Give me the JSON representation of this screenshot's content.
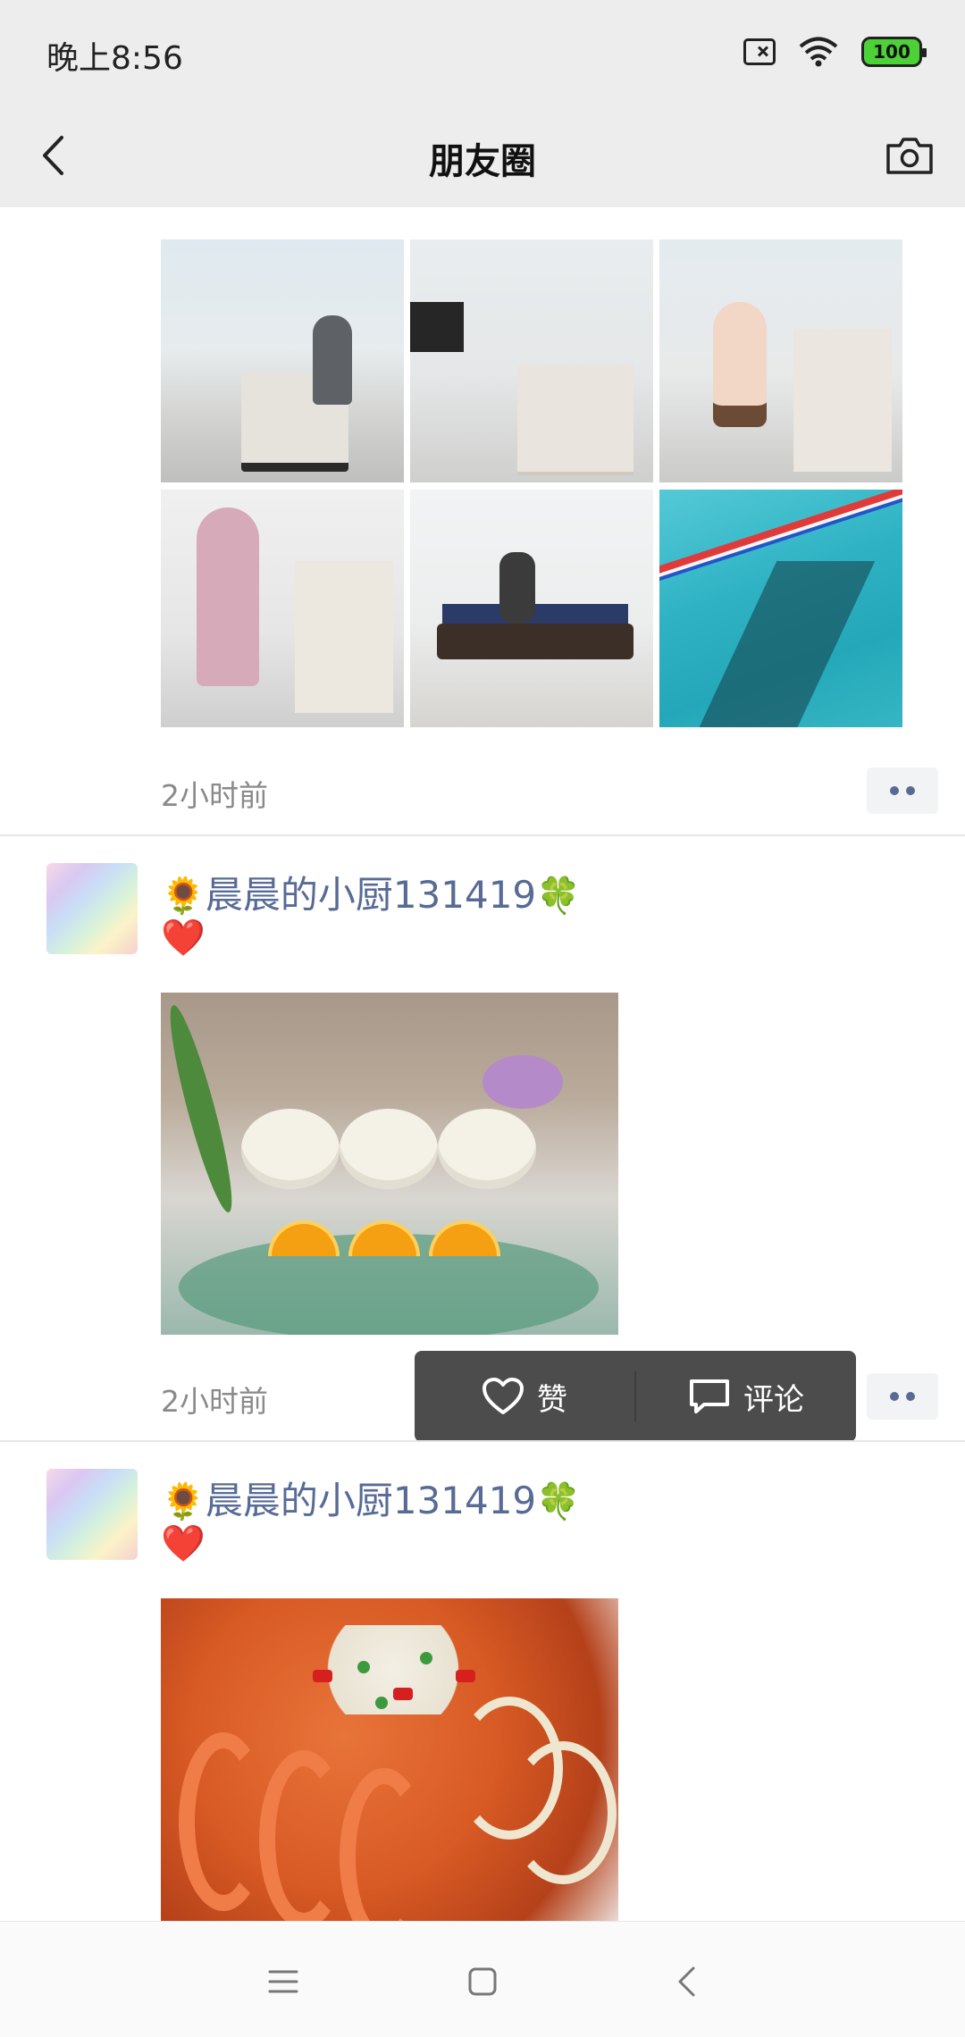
{
  "status_bar": {
    "time": "晚上8:56",
    "battery": "100",
    "icons": [
      "sim-error-icon",
      "wifi-icon",
      "battery-icon"
    ]
  },
  "header": {
    "title": "朋友圈",
    "back_icon": "chevron-left-icon",
    "camera_icon": "camera-icon"
  },
  "posts": [
    {
      "time_ago": "2小时前",
      "photos": [
        {
          "label": "lecture-podium"
        },
        {
          "label": "lecture-skeleton-model"
        },
        {
          "label": "lecture-sticker"
        },
        {
          "label": "lecture-demo"
        },
        {
          "label": "massage-bed"
        },
        {
          "label": "swimming-pool"
        }
      ]
    },
    {
      "nickname_prefix": "🌻",
      "nickname": "晨晨的小厨131419",
      "nickname_suffix": "🍀",
      "content": "❤️",
      "time_ago": "2小时前"
    },
    {
      "nickname_prefix": "🌻",
      "nickname": "晨晨的小厨131419",
      "nickname_suffix": "🍀",
      "content": "❤️"
    }
  ],
  "action_popup": {
    "like_label": "赞",
    "comment_label": "评论"
  },
  "navbar": {
    "icons": [
      "menu-icon",
      "home-icon",
      "back-icon"
    ]
  },
  "colors": {
    "header_bg": "#ededed",
    "link_blue": "#576b95",
    "popup_bg": "#4c4c4c",
    "time_gray": "#8a8a8a"
  }
}
